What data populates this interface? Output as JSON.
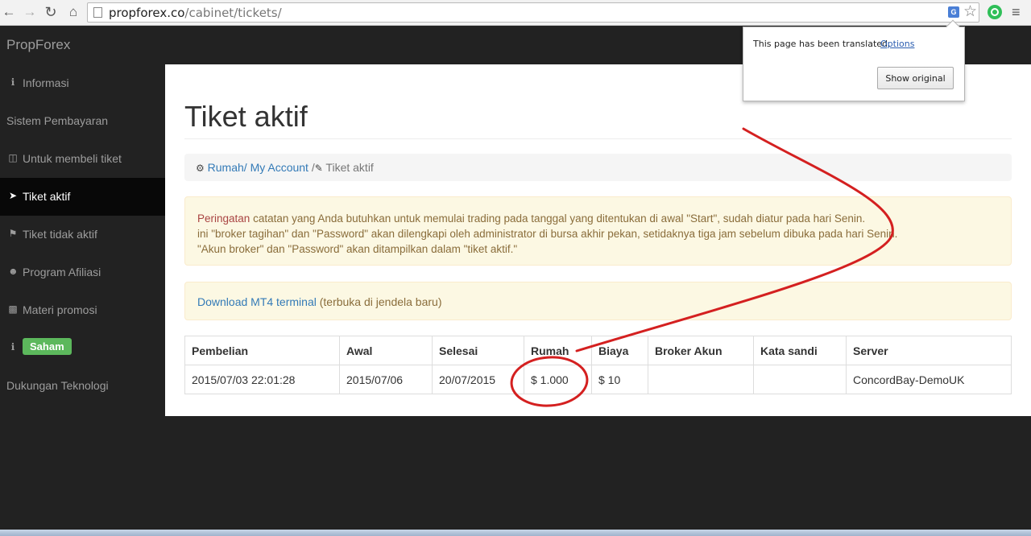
{
  "browser": {
    "url_host": "propforex.co",
    "url_path": "/cabinet/tickets/",
    "icons": [
      "back-arrow-icon",
      "forward-arrow-icon",
      "reload-icon",
      "home-icon",
      "translate-icon",
      "star-icon",
      "extension-icon",
      "menu-icon"
    ]
  },
  "navbar": {
    "brand": "PropForex"
  },
  "sidebar": {
    "items": [
      {
        "label": "Informasi",
        "icon": "info-icon"
      },
      {
        "label": "Sistem Pembayaran",
        "icon": ""
      },
      {
        "label": "Untuk membeli tiket",
        "icon": "money-icon"
      },
      {
        "label": "Tiket aktif",
        "icon": "paper-plane-icon",
        "active": true
      },
      {
        "label": "Tiket tidak aktif",
        "icon": "flag-icon"
      },
      {
        "label": "Program Afiliasi",
        "icon": "user-icon"
      },
      {
        "label": "Materi promosi",
        "icon": "qrcode-icon"
      },
      {
        "label": "Saham",
        "icon": "info-icon",
        "badge": true
      },
      {
        "label": "Dukungan Teknologi",
        "icon": ""
      }
    ]
  },
  "main": {
    "title": "Tiket aktif",
    "breadcrumb": {
      "home": "Rumah",
      "sep1": "/ ",
      "account": "My Account",
      "sep2": " /",
      "current": " Tiket aktif"
    },
    "warning": {
      "label": "Peringatan",
      "line1": " catatan yang Anda butuhkan untuk memulai trading pada tanggal yang ditentukan di awal \"Start\", sudah diatur pada hari Senin.",
      "line2": "ini \"broker tagihan\" dan \"Password\" akan dilengkapi oleh administrator di bursa akhir pekan, setidaknya tiga jam sebelum dibuka pada hari Senin.",
      "line3": "\"Akun broker\" dan \"Password\" akan ditampilkan dalam \"tiket aktif.\""
    },
    "download": {
      "link": "Download MT4 terminal",
      "note": " (terbuka di jendela baru)"
    },
    "table": {
      "headers": [
        "Pembelian",
        "Awal",
        "Selesai",
        "Rumah",
        "Biaya",
        "Broker Akun",
        "Kata sandi",
        "Server"
      ],
      "rows": [
        [
          "2015/07/03 22:01:28",
          "2015/07/06",
          "20/07/2015",
          "$ 1.000",
          "$ 10",
          "",
          "",
          "ConcordBay-DemoUK"
        ]
      ]
    }
  },
  "translate_popup": {
    "message": "This page has been translated.",
    "options": "Options",
    "button": "Show original"
  },
  "annotation_color": "#d42020"
}
